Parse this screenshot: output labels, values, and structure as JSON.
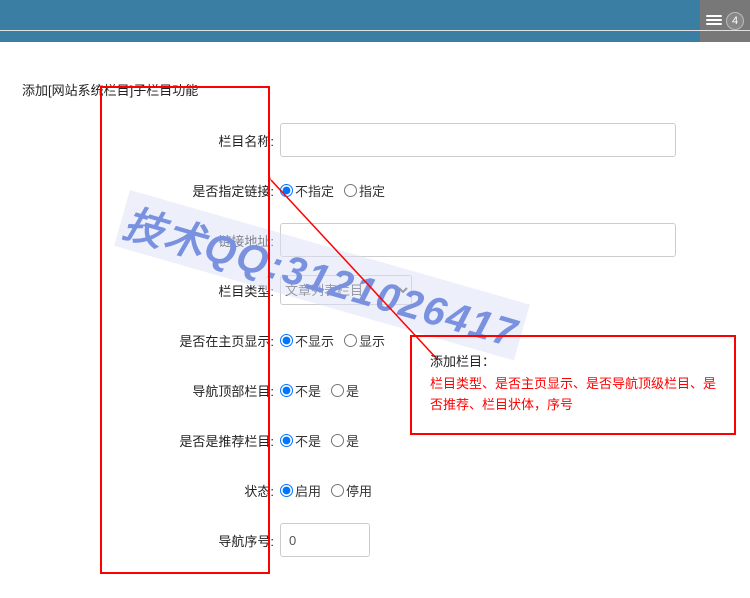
{
  "topbar": {
    "badge_count": "4"
  },
  "page": {
    "title": "添加[网站系统栏目]子栏目功能"
  },
  "form": {
    "name": {
      "label": "栏目名称:",
      "value": ""
    },
    "link_spec": {
      "label": "是否指定链接:",
      "opt0": "不指定",
      "opt1": "指定"
    },
    "link_url": {
      "label": "链接地址:",
      "value": ""
    },
    "type": {
      "label": "栏目类型:",
      "selected": "文章列表栏目"
    },
    "home": {
      "label": "是否在主页显示:",
      "opt0": "不显示",
      "opt1": "显示"
    },
    "nav_top": {
      "label": "导航顶部栏目:",
      "opt0": "不是",
      "opt1": "是"
    },
    "recommend": {
      "label": "是否是推荐栏目:",
      "opt0": "不是",
      "opt1": "是"
    },
    "status": {
      "label": "状态:",
      "opt0": "启用",
      "opt1": "停用"
    },
    "order": {
      "label": "导航序号:",
      "value": "0"
    }
  },
  "annotation": {
    "title": "添加栏目：",
    "text": "栏目类型、是否主页显示、是否导航顶级栏目、是否推荐、栏目状体，序号"
  },
  "watermark": {
    "text": "技术QQ:3121026417"
  }
}
